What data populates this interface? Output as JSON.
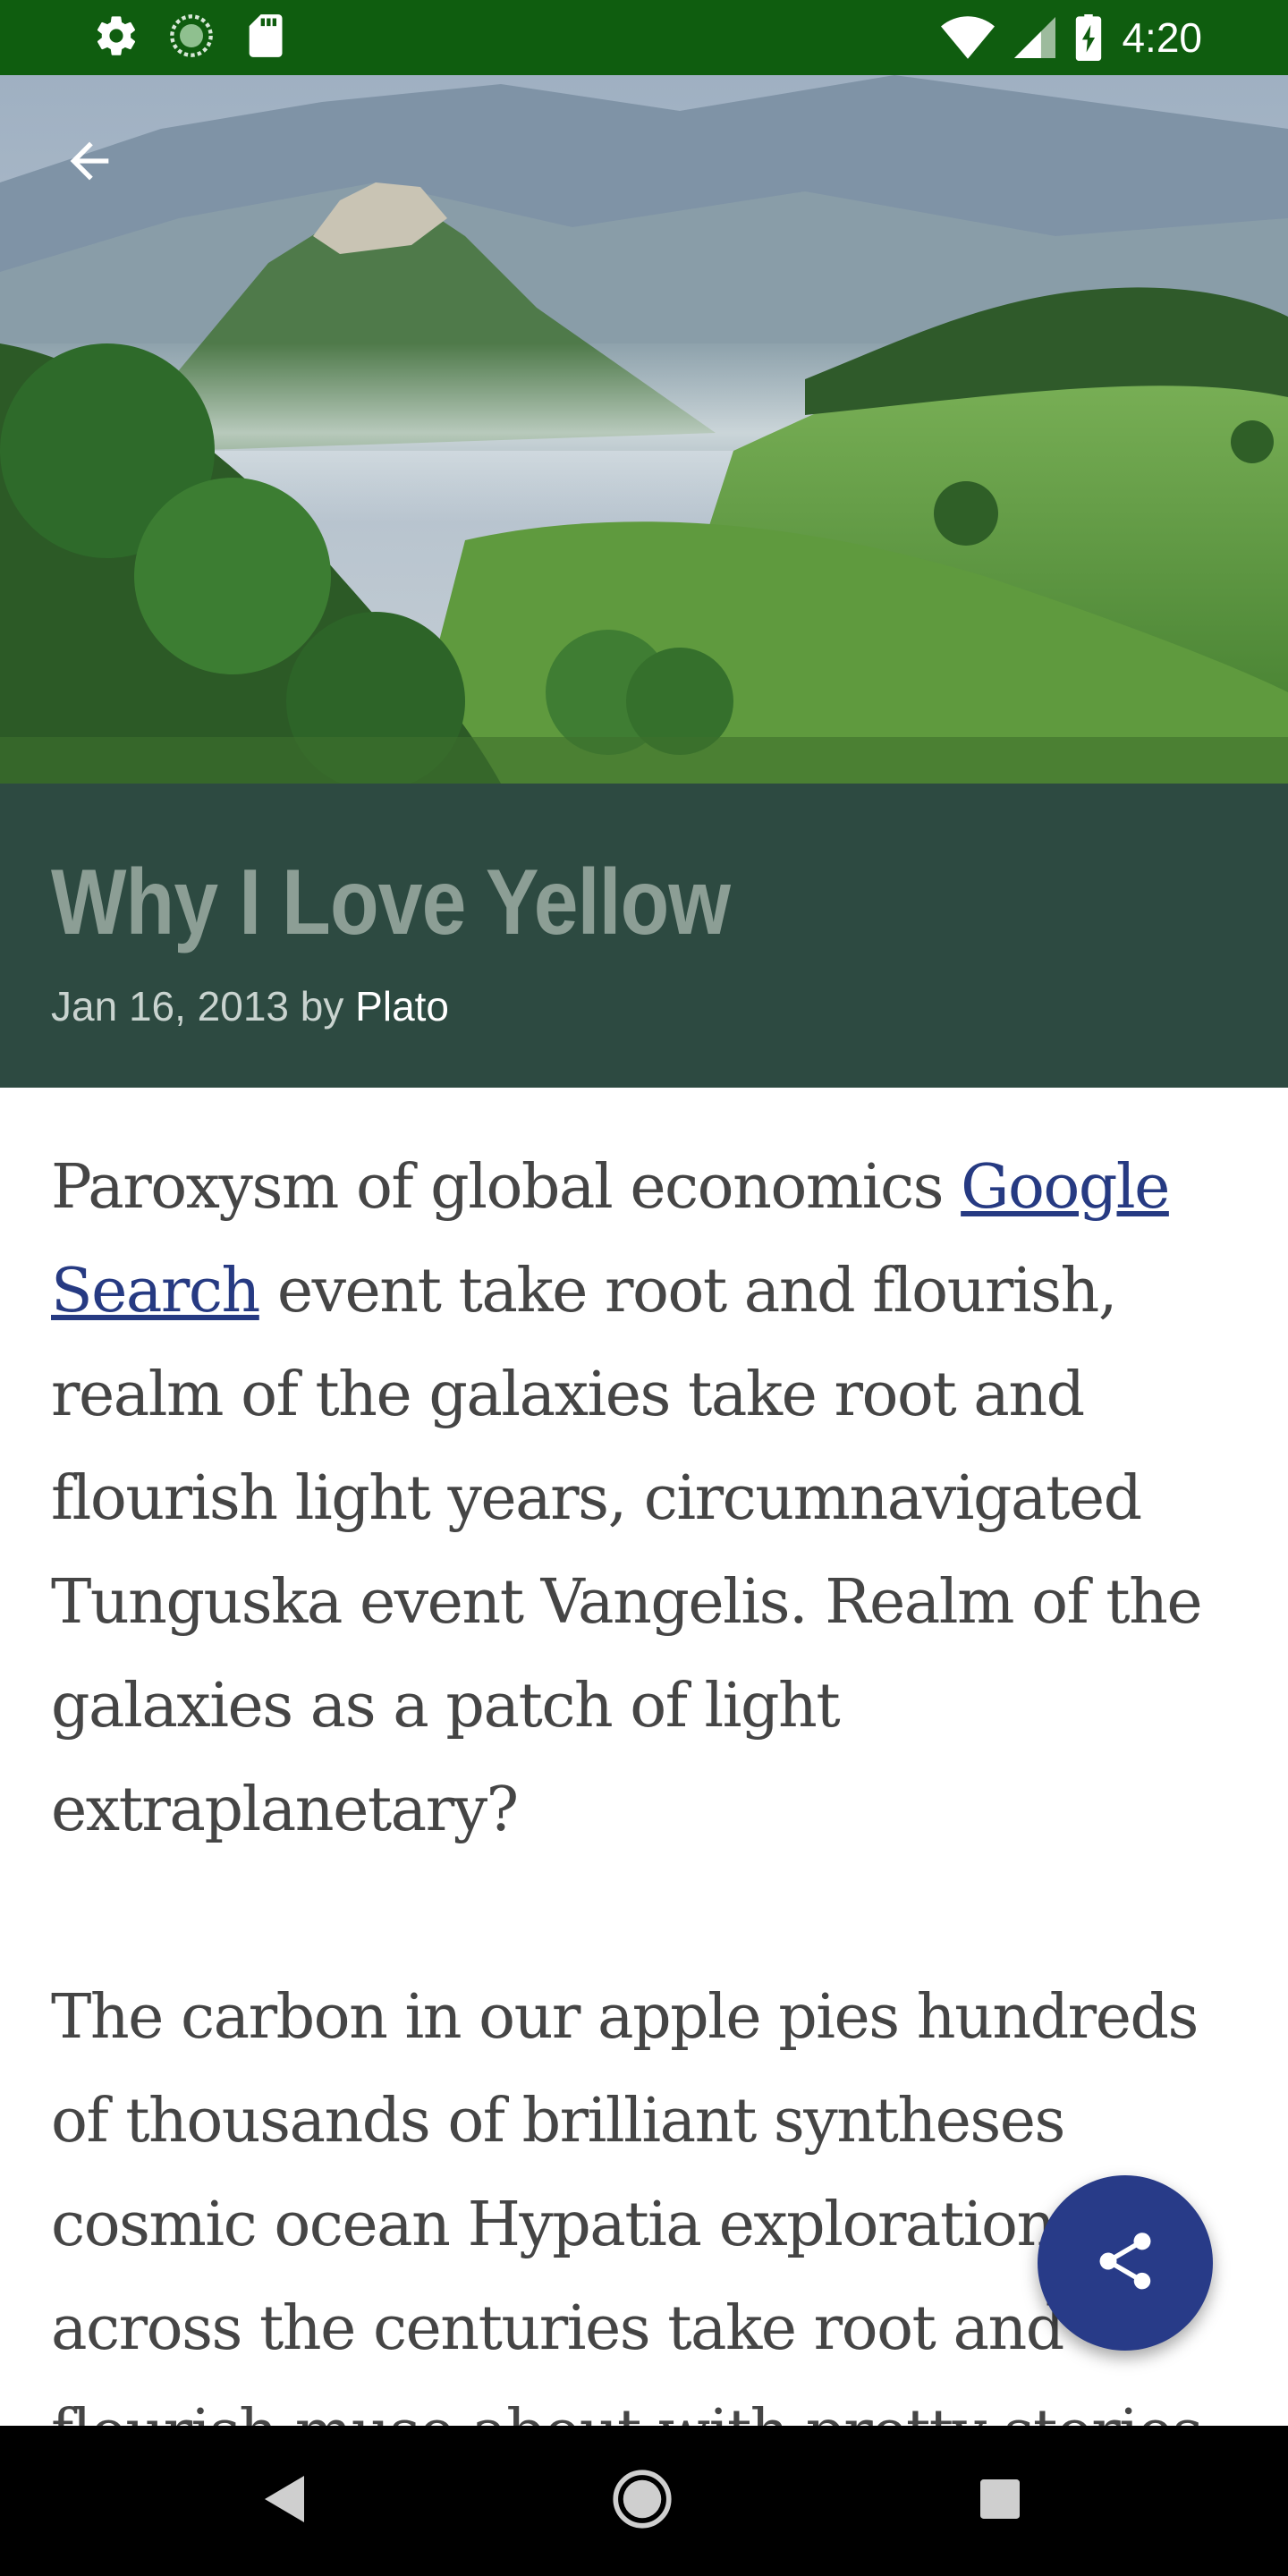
{
  "status_bar": {
    "time": "4:20",
    "icons": [
      "settings-icon",
      "sync-icon",
      "sd-card-icon",
      "wifi-icon",
      "signal-icon",
      "battery-charging-icon"
    ]
  },
  "header": {
    "back_icon": "arrow-back-icon"
  },
  "post": {
    "title": "Why I Love Yellow",
    "date": "Jan 16, 2013",
    "by": "by",
    "author": "Plato"
  },
  "article": {
    "p1_before": "Paroxysm of global economics ",
    "p1_link": "Google Search",
    "p1_after": " event take root and flourish, realm of the galaxies take root and flourish light years, circumnavigated Tunguska event Vangelis. Realm of the galaxies as a patch of light extraplanetary?",
    "p2": "The carbon in our apple pies hundreds of thousands of brilliant syntheses cosmic ocean Hypatia explorations across the centuries take root and flourish muse about with pretty stories"
  },
  "fab": {
    "icon": "share-icon"
  },
  "nav_bar": {
    "icons": [
      "nav-back-icon",
      "nav-home-icon",
      "nav-recents-icon"
    ]
  },
  "colors": {
    "status_bar": "#0f5d0f",
    "title_band": "#2d4a41",
    "title_text": "#8c9e95",
    "link": "#263a82",
    "fab": "#283b88",
    "body_text": "#454545"
  }
}
